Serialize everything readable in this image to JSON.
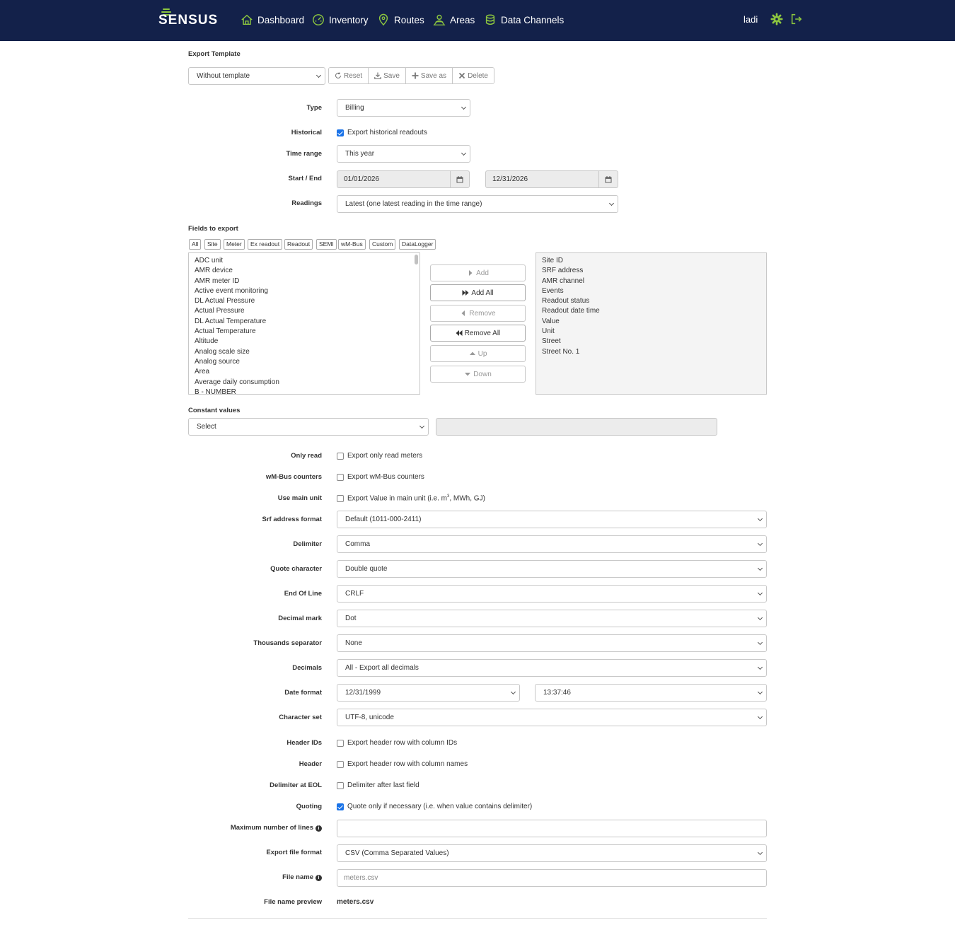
{
  "nav": {
    "logo": "SENSUS",
    "items": [
      {
        "label": "Dashboard",
        "icon": "home-icon"
      },
      {
        "label": "Inventory",
        "icon": "gauge-icon"
      },
      {
        "label": "Routes",
        "icon": "location-pin-icon"
      },
      {
        "label": "Areas",
        "icon": "user-map-icon"
      },
      {
        "label": "Data Channels",
        "icon": "database-icon"
      }
    ],
    "user": "ladi",
    "colors": {
      "bg": "#13214a",
      "accent": "#8cc63f"
    }
  },
  "template": {
    "title": "Export Template",
    "selected": "Without template",
    "buttons": {
      "reset": "Reset",
      "save": "Save",
      "save_as": "Save as",
      "delete": "Delete"
    }
  },
  "type": {
    "label": "Type",
    "value": "Billing"
  },
  "historical": {
    "label": "Historical",
    "checkbox": "Export historical readouts",
    "checked": true
  },
  "time_range": {
    "label": "Time range",
    "value": "This year"
  },
  "start_end": {
    "label": "Start / End",
    "start": "01/01/2026",
    "end": "12/31/2026"
  },
  "readings": {
    "label": "Readings",
    "value": "Latest (one latest reading in the time range)"
  },
  "fields": {
    "title": "Fields to export",
    "filters": [
      "All",
      "Site",
      "Meter",
      "Ex readout",
      "Readout",
      "SEMI",
      "wM-Bus",
      "Custom",
      "DataLogger"
    ],
    "available": [
      "ADC unit",
      "AMR device",
      "AMR meter ID",
      "Active event monitoring",
      "DL Actual Pressure",
      "Actual Pressure",
      "DL Actual Temperature",
      "Actual Temperature",
      "Altitude",
      "Analog scale size",
      "Analog source",
      "Area",
      "Average daily consumption",
      "B - NUMBER"
    ],
    "selected": [
      "Site ID",
      "SRF address",
      "AMR channel",
      "Events",
      "Readout status",
      "Readout date time",
      "Value",
      "Unit",
      "Street",
      "Street No. 1"
    ],
    "buttons": {
      "add": "Add",
      "add_all": "Add All",
      "remove": "Remove",
      "remove_all": "Remove All",
      "up": "Up",
      "down": "Down"
    }
  },
  "constant": {
    "title": "Constant values",
    "select": "Select"
  },
  "only_read": {
    "label": "Only read",
    "checkbox": "Export only read meters"
  },
  "wmbus": {
    "label": "wM-Bus counters",
    "checkbox": "Export wM-Bus counters"
  },
  "main_unit": {
    "label": "Use main unit",
    "checkbox_a": "Export Value in main unit (i.e. m",
    "checkbox_sup": "3",
    "checkbox_b": ", MWh, GJ)"
  },
  "srf": {
    "label": "Srf address format",
    "value": "Default (1011-000-2411)"
  },
  "delimiter": {
    "label": "Delimiter",
    "value": "Comma"
  },
  "quote_char": {
    "label": "Quote character",
    "value": "Double quote"
  },
  "eol": {
    "label": "End Of Line",
    "value": "CRLF"
  },
  "decimal_mark": {
    "label": "Decimal mark",
    "value": "Dot"
  },
  "thousands": {
    "label": "Thousands separator",
    "value": "None"
  },
  "decimals": {
    "label": "Decimals",
    "value": "All - Export all decimals"
  },
  "date_format": {
    "label": "Date format",
    "date": "12/31/1999",
    "time": "13:37:46"
  },
  "charset": {
    "label": "Character set",
    "value": "UTF-8, unicode"
  },
  "header_ids": {
    "label": "Header IDs",
    "checkbox": "Export header row with column IDs"
  },
  "header": {
    "label": "Header",
    "checkbox": "Export header row with column names"
  },
  "delim_eol": {
    "label": "Delimiter at EOL",
    "checkbox": "Delimiter after last field"
  },
  "quoting": {
    "label": "Quoting",
    "checkbox": "Quote only if necessary (i.e. when value contains delimiter)",
    "checked": true
  },
  "max_lines": {
    "label": "Maximum number of lines"
  },
  "file_format": {
    "label": "Export file format",
    "value": "CSV (Comma Separated Values)"
  },
  "file_name": {
    "label": "File name",
    "placeholder": "meters.csv"
  },
  "file_preview": {
    "label": "File name preview",
    "value": "meters.csv"
  }
}
